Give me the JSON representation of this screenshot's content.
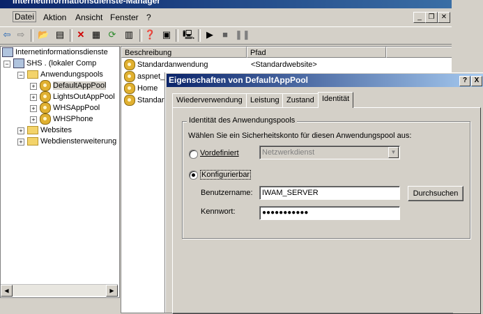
{
  "window": {
    "title": "Internetinformationsdienste-Manager"
  },
  "menu": [
    {
      "label": "Datei"
    },
    {
      "label": "Aktion"
    },
    {
      "label": "Ansicht"
    },
    {
      "label": "Fenster"
    },
    {
      "label": "?"
    }
  ],
  "tree": {
    "root": "Internetinformationsdienste",
    "server": "SHS . (lokaler Comp",
    "app_pools": "Anwendungspools",
    "pools": [
      "DefaultAppPool",
      "LightsOutAppPool",
      "WHSAppPool",
      "WHSPhone"
    ],
    "websites": "Websites",
    "webservice_ext": "Webdiensterweiterung"
  },
  "list": {
    "columns": [
      "Beschreibung",
      "Pfad"
    ],
    "rows": [
      {
        "name": "Standardanwendung",
        "path": "<Standardwebsite>"
      },
      {
        "name": "aspnet_c",
        "path": ""
      },
      {
        "name": "Home",
        "path": ""
      },
      {
        "name": "Standar",
        "path": ""
      }
    ]
  },
  "dialog": {
    "title": "Eigenschaften von DefaultAppPool",
    "help_btn": "?",
    "close_btn": "X",
    "tabs": [
      "Wiederverwendung",
      "Leistung",
      "Zustand",
      "Identität"
    ],
    "active_tab": "Identität",
    "group_label": "Identität des Anwendungspools",
    "instruction": "Wählen Sie ein Sicherheitskonto für diesen Anwendungspool aus:",
    "predefined_label": "Vordefiniert",
    "predefined_value": "Netzwerkdienst",
    "configurable_label": "Konfigurierbar",
    "username_label": "Benutzername:",
    "username_value": "IWAM_SERVER",
    "browse_btn": "Durchsuchen",
    "password_label": "Kennwort:",
    "password_value": "●●●●●●●●●●●"
  }
}
